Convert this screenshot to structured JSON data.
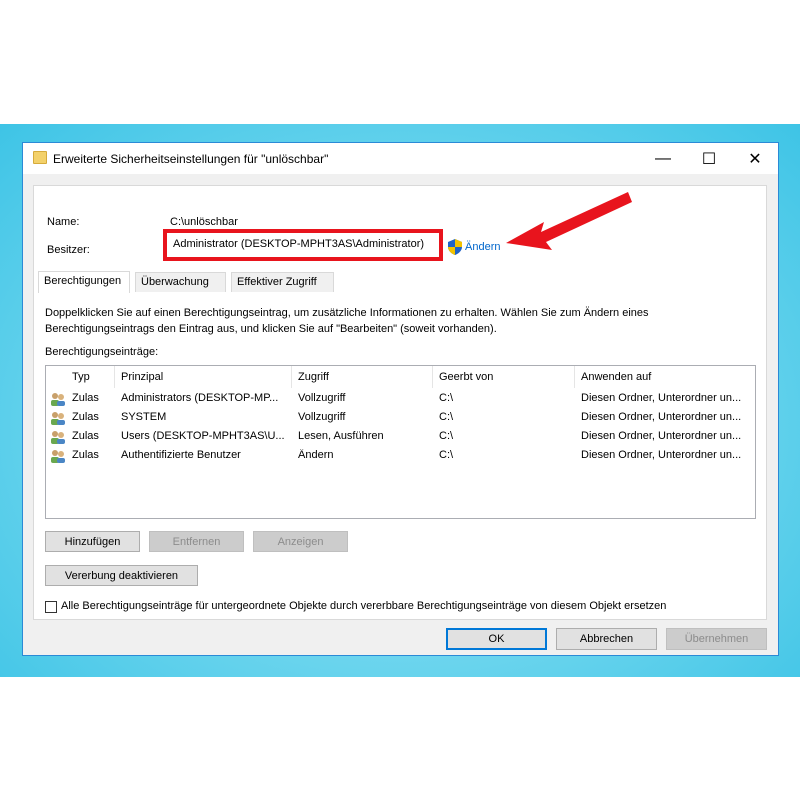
{
  "window": {
    "title": "Erweiterte Sicherheitseinstellungen für \"unlöschbar\"",
    "minimize": "—",
    "maximize": "☐",
    "close": "✕"
  },
  "info": {
    "name_label": "Name:",
    "name_value": "C:\\unlöschbar",
    "owner_label": "Besitzer:",
    "owner_value": "Administrator (DESKTOP-MPHT3AS\\Administrator)",
    "change_link": "Ändern"
  },
  "tabs": [
    {
      "label": "Berechtigungen",
      "active": true
    },
    {
      "label": "Überwachung",
      "active": false
    },
    {
      "label": "Effektiver Zugriff",
      "active": false
    }
  ],
  "permissions": {
    "description": "Doppelklicken Sie auf einen Berechtigungseintrag, um zusätzliche Informationen zu erhalten. Wählen Sie zum Ändern eines Berechtigungseintrags den Eintrag aus, und klicken Sie auf \"Bearbeiten\" (soweit vorhanden).",
    "entries_label": "Berechtigungseinträge:",
    "columns": [
      "Typ",
      "Prinzipal",
      "Zugriff",
      "Geerbt von",
      "Anwenden auf"
    ],
    "rows": [
      {
        "type": "Zulas",
        "principal": "Administrators (DESKTOP-MP...",
        "access": "Vollzugriff",
        "inherited": "C:\\",
        "applies": "Diesen Ordner, Unterordner un..."
      },
      {
        "type": "Zulas",
        "principal": "SYSTEM",
        "access": "Vollzugriff",
        "inherited": "C:\\",
        "applies": "Diesen Ordner, Unterordner un..."
      },
      {
        "type": "Zulas",
        "principal": "Users (DESKTOP-MPHT3AS\\U...",
        "access": "Lesen, Ausführen",
        "inherited": "C:\\",
        "applies": "Diesen Ordner, Unterordner un..."
      },
      {
        "type": "Zulas",
        "principal": "Authentifizierte Benutzer",
        "access": "Ändern",
        "inherited": "C:\\",
        "applies": "Diesen Ordner, Unterordner un..."
      }
    ],
    "buttons": {
      "add": "Hinzufügen",
      "remove": "Entfernen",
      "view": "Anzeigen",
      "disable_inheritance": "Vererbung deaktivieren"
    },
    "replace_checkbox_label": "Alle Berechtigungseinträge für untergeordnete Objekte durch vererbbare Berechtigungseinträge von diesem Objekt ersetzen",
    "replace_checked": false
  },
  "footer": {
    "ok": "OK",
    "cancel": "Abbrechen",
    "apply": "Übernehmen"
  },
  "colors": {
    "highlight_box": "#e8141d",
    "arrow": "#e8141d",
    "link": "#0066cc",
    "window_border": "#2b8ad6"
  }
}
